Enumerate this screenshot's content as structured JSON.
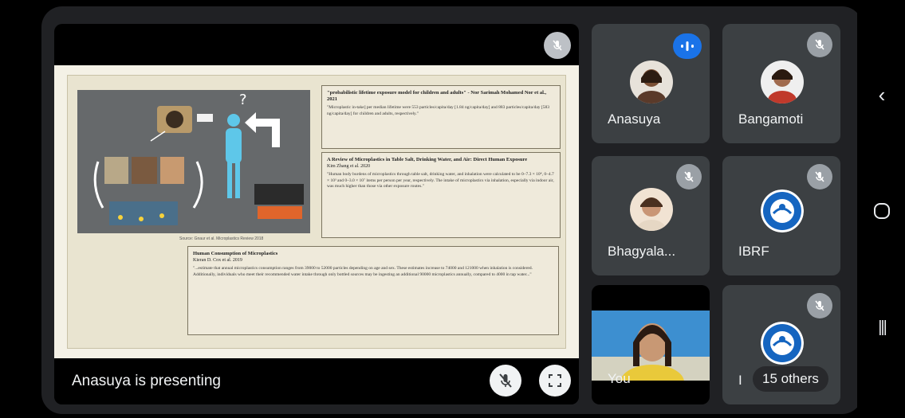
{
  "presentation": {
    "caption": "Anasuya is presenting",
    "slide": {
      "box1": {
        "title": "\"probabilistic lifetime exposure model for children and adults\" - Nor Sarimah Mohamed Nor et al., 2021",
        "body": "\"Microplastic in-take] per median lifetime were 553 particles/capita/day [1.84 ng/capita/day] and 883 particles/capita/day [583 ng/capita/day] for children and adults, respectively.\""
      },
      "box2": {
        "title": "A Review of Microplastics in Table Salt, Drinking Water, and Air: Direct Human Exposure",
        "author": "Kim Zhang et al. 2020",
        "body": "\"Human body burdens of microplastics through table salt, drinking water, and inhalation were calculated to be 0–7.3 × 10⁴, 0–4.7 × 10³ and 0–3.0 × 10⁷ items per person per year, respectively. The intake of microplastics via inhalation, especially via indoor air, was much higher than those via other exposure routes.\""
      },
      "box3": {
        "title": "Human Consumption of Microplastics",
        "author": "Kieran D. Cox et al. 2019",
        "body": "\"...estimate that annual microplastics consumption ranges from 39000 to 52000 particles depending on age and sex. These estimates increase to 74000 and 121000 when inhalation is considered. Additionally, individuals who meet their recommended water intake through only bottled sources may be ingesting an additional 90000 microplastics annually, compared to 4000 in tap water...\""
      },
      "figure_caption": "Source: Gnaur et al. Microplastics Review 2018"
    }
  },
  "participants": [
    {
      "name": "Anasuya",
      "status": "speaking"
    },
    {
      "name": "Bangamoti",
      "status": "muted"
    },
    {
      "name": "Bhagyala...",
      "status": "muted"
    },
    {
      "name": "IBRF",
      "status": "muted"
    },
    {
      "name": "You",
      "status": "camera"
    },
    {
      "name": "I",
      "others": "15 others",
      "status": "muted"
    }
  ],
  "colors": {
    "background": "#202124",
    "tile": "#3c4043",
    "speaking": "#1a73e8",
    "ibrf_logo": "#1565c0"
  },
  "icons": {
    "nav_back": "‹",
    "nav_home": "○",
    "nav_recents": "|||"
  }
}
